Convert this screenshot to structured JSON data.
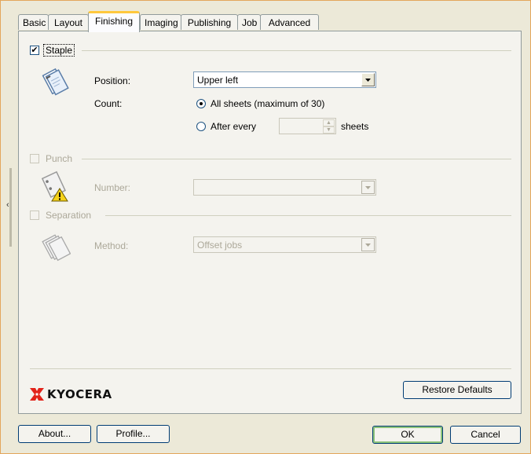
{
  "tabs": [
    {
      "label": "Basic"
    },
    {
      "label": "Layout"
    },
    {
      "label": "Finishing",
      "active": true
    },
    {
      "label": "Imaging"
    },
    {
      "label": "Publishing"
    },
    {
      "label": "Job"
    },
    {
      "label": "Advanced"
    }
  ],
  "staple": {
    "label": "Staple",
    "checked": true,
    "position_label": "Position:",
    "position_value": "Upper left",
    "count_label": "Count:",
    "all_sheets_label": "All sheets (maximum of 30)",
    "after_every_label": "After every",
    "sheets_label": "sheets",
    "count_mode": "all_sheets"
  },
  "punch": {
    "label": "Punch",
    "checked": false,
    "number_label": "Number:",
    "number_value": ""
  },
  "separation": {
    "label": "Separation",
    "checked": false,
    "method_label": "Method:",
    "method_value": "Offset jobs"
  },
  "brand": {
    "name": "KYOCERA",
    "color": "#E2231A"
  },
  "buttons": {
    "restore_defaults": "Restore Defaults",
    "about": "About...",
    "profile": "Profile...",
    "ok": "OK",
    "cancel": "Cancel"
  },
  "icons": {
    "staple": "staple-document-icon",
    "punch": "punch-warning-icon",
    "separation": "stacked-pages-icon",
    "dropdown": "chevron-down-icon"
  }
}
